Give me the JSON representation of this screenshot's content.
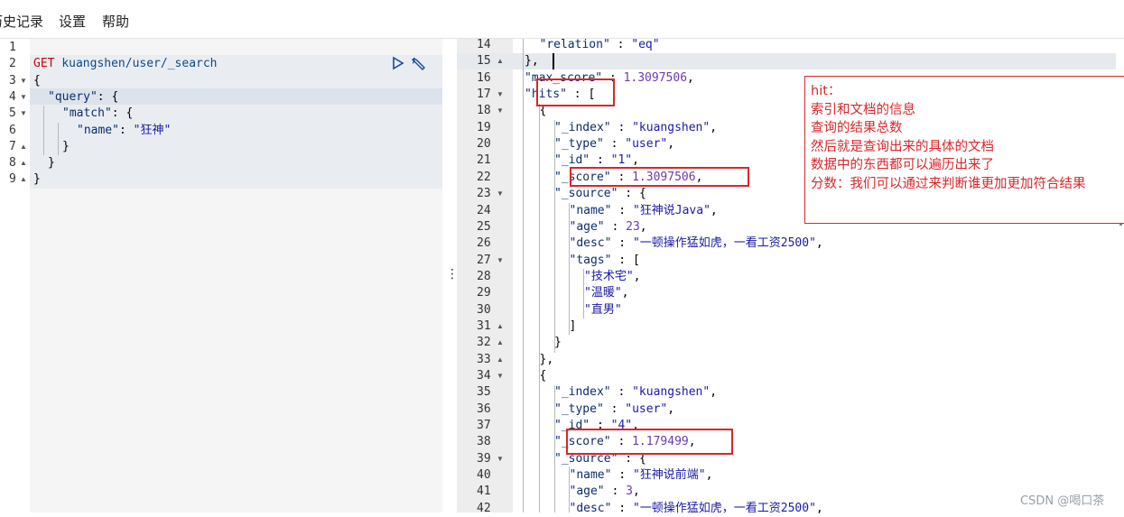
{
  "menu": {
    "items": [
      {
        "label": "历史记录"
      },
      {
        "label": "设置"
      },
      {
        "label": "帮助"
      }
    ]
  },
  "request_editor": {
    "lines": [
      {
        "n": "1",
        "fold": "",
        "indent": 0,
        "text": ""
      },
      {
        "n": "2",
        "fold": "",
        "indent": 0,
        "text": ""
      },
      {
        "n": "3",
        "fold": "▼",
        "indent": 0,
        "text": "{"
      },
      {
        "n": "4",
        "fold": "▼",
        "indent": 1,
        "text": ""
      },
      {
        "n": "5",
        "fold": "▼",
        "indent": 2,
        "text": ""
      },
      {
        "n": "6",
        "fold": "",
        "indent": 3,
        "text": ""
      },
      {
        "n": "7",
        "fold": "▲",
        "indent": 2,
        "text": "}"
      },
      {
        "n": "8",
        "fold": "▲",
        "indent": 1,
        "text": "}"
      },
      {
        "n": "9",
        "fold": "▲",
        "indent": 0,
        "text": "}"
      }
    ],
    "method": "GET",
    "path": "kuangshen/user/_search",
    "query_key": "\"query\"",
    "query_rest": ": {",
    "match_key": "\"match\"",
    "match_rest": ": {",
    "name_key": "\"name\"",
    "name_colon": ": ",
    "name_value": "\"狂神\"",
    "icons": [
      "play-icon",
      "wrench-icon"
    ]
  },
  "response": {
    "lines": [
      {
        "n": "14",
        "fold": "",
        "indent": 2,
        "key": "\"relation\"",
        "sep": " : ",
        "val": "\"eq\"",
        "vt": "str",
        "tail": ""
      },
      {
        "n": "15",
        "fold": "▲",
        "indent": 1,
        "key": "",
        "sep": "",
        "val": "",
        "vt": "",
        "tail": "},"
      },
      {
        "n": "16",
        "fold": "",
        "indent": 1,
        "key": "\"max_score\"",
        "sep": " : ",
        "val": "1.3097506",
        "vt": "num",
        "tail": ","
      },
      {
        "n": "17",
        "fold": "▼",
        "indent": 1,
        "key": "\"hits\"",
        "sep": " : ",
        "val": "",
        "vt": "",
        "tail": "["
      },
      {
        "n": "18",
        "fold": "▼",
        "indent": 2,
        "key": "",
        "sep": "",
        "val": "",
        "vt": "",
        "tail": "{"
      },
      {
        "n": "19",
        "fold": "",
        "indent": 3,
        "key": "\"_index\"",
        "sep": " : ",
        "val": "\"kuangshen\"",
        "vt": "str",
        "tail": ","
      },
      {
        "n": "20",
        "fold": "",
        "indent": 3,
        "key": "\"_type\"",
        "sep": " : ",
        "val": "\"user\"",
        "vt": "str",
        "tail": ","
      },
      {
        "n": "21",
        "fold": "",
        "indent": 3,
        "key": "\"_id\"",
        "sep": " : ",
        "val": "\"1\"",
        "vt": "str",
        "tail": ","
      },
      {
        "n": "22",
        "fold": "",
        "indent": 3,
        "key": "\"_score\"",
        "sep": " : ",
        "val": "1.3097506",
        "vt": "num",
        "tail": ","
      },
      {
        "n": "23",
        "fold": "▼",
        "indent": 3,
        "key": "\"_source\"",
        "sep": " : ",
        "val": "",
        "vt": "",
        "tail": "{"
      },
      {
        "n": "24",
        "fold": "",
        "indent": 4,
        "key": "\"name\"",
        "sep": " : ",
        "val": "\"狂神说Java\"",
        "vt": "str",
        "tail": ","
      },
      {
        "n": "25",
        "fold": "",
        "indent": 4,
        "key": "\"age\"",
        "sep": " : ",
        "val": "23",
        "vt": "num",
        "tail": ","
      },
      {
        "n": "26",
        "fold": "",
        "indent": 4,
        "key": "\"desc\"",
        "sep": " : ",
        "val": "\"一顿操作猛如虎，一看工资2500\"",
        "vt": "str",
        "tail": ","
      },
      {
        "n": "27",
        "fold": "▼",
        "indent": 4,
        "key": "\"tags\"",
        "sep": " : ",
        "val": "",
        "vt": "",
        "tail": "["
      },
      {
        "n": "28",
        "fold": "",
        "indent": 5,
        "key": "",
        "sep": "",
        "val": "\"技术宅\"",
        "vt": "str",
        "tail": ","
      },
      {
        "n": "29",
        "fold": "",
        "indent": 5,
        "key": "",
        "sep": "",
        "val": "\"温暖\"",
        "vt": "str",
        "tail": ","
      },
      {
        "n": "30",
        "fold": "",
        "indent": 5,
        "key": "",
        "sep": "",
        "val": "\"直男\"",
        "vt": "str",
        "tail": ""
      },
      {
        "n": "31",
        "fold": "▲",
        "indent": 4,
        "key": "",
        "sep": "",
        "val": "",
        "vt": "",
        "tail": "]"
      },
      {
        "n": "32",
        "fold": "▲",
        "indent": 3,
        "key": "",
        "sep": "",
        "val": "",
        "vt": "",
        "tail": "}"
      },
      {
        "n": "33",
        "fold": "▲",
        "indent": 2,
        "key": "",
        "sep": "",
        "val": "",
        "vt": "",
        "tail": "},"
      },
      {
        "n": "34",
        "fold": "▼",
        "indent": 2,
        "key": "",
        "sep": "",
        "val": "",
        "vt": "",
        "tail": "{"
      },
      {
        "n": "35",
        "fold": "",
        "indent": 3,
        "key": "\"_index\"",
        "sep": " : ",
        "val": "\"kuangshen\"",
        "vt": "str",
        "tail": ","
      },
      {
        "n": "36",
        "fold": "",
        "indent": 3,
        "key": "\"_type\"",
        "sep": " : ",
        "val": "\"user\"",
        "vt": "str",
        "tail": ","
      },
      {
        "n": "37",
        "fold": "",
        "indent": 3,
        "key": "\"_id\"",
        "sep": " : ",
        "val": "\"4\"",
        "vt": "str",
        "tail": ","
      },
      {
        "n": "38",
        "fold": "",
        "indent": 3,
        "key": "\"_score\"",
        "sep": " : ",
        "val": "1.179499",
        "vt": "num",
        "tail": ","
      },
      {
        "n": "39",
        "fold": "▼",
        "indent": 3,
        "key": "\"_source\"",
        "sep": " : ",
        "val": "",
        "vt": "",
        "tail": "{"
      },
      {
        "n": "40",
        "fold": "",
        "indent": 4,
        "key": "\"name\"",
        "sep": " : ",
        "val": "\"狂神说前端\"",
        "vt": "str",
        "tail": ","
      },
      {
        "n": "41",
        "fold": "",
        "indent": 4,
        "key": "\"age\"",
        "sep": " : ",
        "val": "3",
        "vt": "num",
        "tail": ","
      },
      {
        "n": "42",
        "fold": "",
        "indent": 4,
        "key": "\"desc\"",
        "sep": " : ",
        "val": "\"一顿操作猛如虎，一看工资2500\"",
        "vt": "str",
        "tail": ","
      }
    ]
  },
  "annotation": {
    "lines": [
      "hit：",
      "索引和文档的信息",
      "查询的结果总数",
      "然后就是查询出来的具体的文档",
      "数据中的东西都可以遍历出来了",
      "分数：我们可以通过来判断谁更加更加符合结果"
    ],
    "color": "#d9262a"
  },
  "watermark": "CSDN @喝口茶",
  "colors": {
    "method": "#c5060b",
    "path": "#0c4a8a",
    "key": "#0d2c6b",
    "string": "#1a1aa6",
    "number": "#6b3ab0",
    "highlight_box": "#d9262a"
  }
}
